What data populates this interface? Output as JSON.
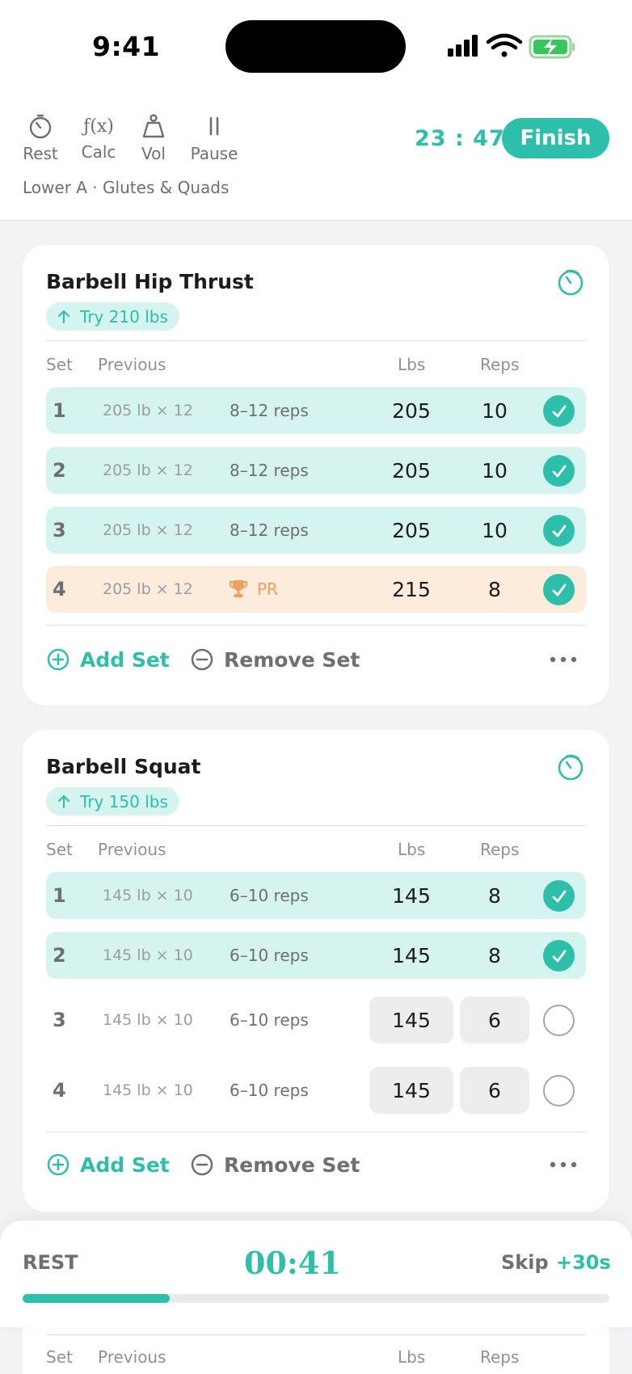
{
  "status_bar": {
    "time": "9:41"
  },
  "toolbar": {
    "tools": [
      {
        "label": "Rest",
        "icon": "stopwatch-icon"
      },
      {
        "label": "Calc",
        "icon": "function-icon",
        "glyph": "ƒ(x)"
      },
      {
        "label": "Vol",
        "icon": "weight-icon"
      },
      {
        "label": "Pause",
        "icon": "pause-icon"
      }
    ],
    "elapsed": "23 : 47",
    "finish_label": "Finish",
    "subtitle": "Lower A · Glutes & Quads"
  },
  "columns": {
    "set": "Set",
    "previous": "Previous",
    "lbs": "Lbs",
    "reps": "Reps"
  },
  "exercises": [
    {
      "name": "Barbell Hip Thrust",
      "suggestion": "Try 210 lbs",
      "sets": [
        {
          "set": "1",
          "previous": "205 lb × 12",
          "target": "8–12 reps",
          "lbs": "205",
          "reps": "10",
          "done": true
        },
        {
          "set": "2",
          "previous": "205 lb × 12",
          "target": "8–12 reps",
          "lbs": "205",
          "reps": "10",
          "done": true
        },
        {
          "set": "3",
          "previous": "205 lb × 12",
          "target": "8–12 reps",
          "lbs": "205",
          "reps": "10",
          "done": true
        },
        {
          "set": "4",
          "previous": "205 lb × 12",
          "target": "PR",
          "lbs": "215",
          "reps": "8",
          "done": true,
          "pr": true
        }
      ]
    },
    {
      "name": "Barbell Squat",
      "suggestion": "Try 150 lbs",
      "sets": [
        {
          "set": "1",
          "previous": "145 lb × 10",
          "target": "6–10 reps",
          "lbs": "145",
          "reps": "8",
          "done": true
        },
        {
          "set": "2",
          "previous": "145 lb × 10",
          "target": "6–10 reps",
          "lbs": "145",
          "reps": "8",
          "done": true
        },
        {
          "set": "3",
          "previous": "145 lb × 10",
          "target": "6–10 reps",
          "lbs": "145",
          "reps": "6",
          "done": false
        },
        {
          "set": "4",
          "previous": "145 lb × 10",
          "target": "6–10 reps",
          "lbs": "145",
          "reps": "6",
          "done": false
        }
      ]
    }
  ],
  "actions": {
    "add_set": "Add Set",
    "remove_set": "Remove Set"
  },
  "rest_timer": {
    "label": "REST",
    "time": "00:41",
    "skip_label": "Skip",
    "add_label": "+30s",
    "progress": 0.25
  },
  "colors": {
    "accent": "#2dbfa9",
    "done_row": "#d5f3ef",
    "pr_row": "#fdebdc",
    "pr_text": "#f0a05a"
  }
}
